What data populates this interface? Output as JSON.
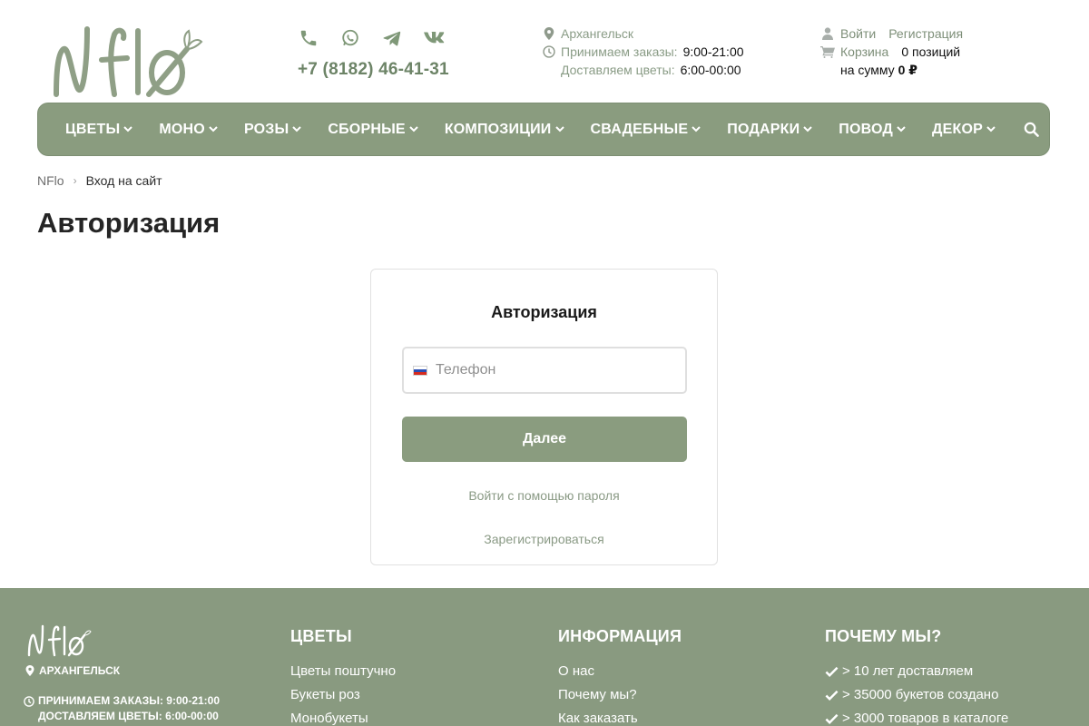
{
  "brand": {
    "logo_text": "NFlo"
  },
  "header": {
    "social_icons": [
      "phone-icon",
      "whatsapp-icon",
      "telegram-icon",
      "vk-icon"
    ],
    "phone": "+7 (8182) 46-41-31",
    "city": "Архангельск",
    "orders_label": "Принимаем заказы:",
    "orders_hours": "9:00-21:00",
    "delivery_label": "Доставляем цветы:",
    "delivery_hours": "6:00-00:00",
    "login": "Войти",
    "register": "Регистрация",
    "cart_label": "Корзина",
    "cart_count": "0 позиций",
    "cart_sum_label": "на сумму",
    "cart_sum": "0 ₽"
  },
  "nav": {
    "items": [
      "ЦВЕТЫ",
      "МОНО",
      "РОЗЫ",
      "СБОРНЫЕ",
      "КОМПОЗИЦИИ",
      "СВАДЕБНЫЕ",
      "ПОДАРКИ",
      "ПОВОД",
      "ДЕКОР"
    ]
  },
  "breadcrumb": {
    "home": "NFlo",
    "separator": "›",
    "current": "Вход на сайт"
  },
  "page_title": "Авторизация",
  "auth": {
    "title": "Авторизация",
    "phone_placeholder": "Телефон",
    "submit": "Далее",
    "password_link": "Войти с помощью пароля",
    "register_link": "Зарегистрироваться"
  },
  "footer": {
    "city": "АРХАНГЕЛЬСК",
    "orders": "ПРИНИМАЕМ ЗАКАЗЫ: 9:00-21:00",
    "delivery": "ДОСТАВЛЯЕМ ЦВЕТЫ: 6:00-00:00",
    "flowers": {
      "title": "ЦВЕТЫ",
      "links": [
        "Цветы поштучно",
        "Букеты роз",
        "Монобукеты"
      ]
    },
    "info": {
      "title": "ИНФОРМАЦИЯ",
      "links": [
        "О нас",
        "Почему мы?",
        "Как заказать"
      ]
    },
    "why": {
      "title": "ПОЧЕМУ МЫ?",
      "items": [
        "> 10 лет доставляем",
        "> 35000 букетов создано",
        "> 3000 товаров в каталоге"
      ]
    }
  },
  "colors": {
    "accent": "#8a9c7f",
    "link": "#8a9a85",
    "text": "#2b2b2b"
  }
}
